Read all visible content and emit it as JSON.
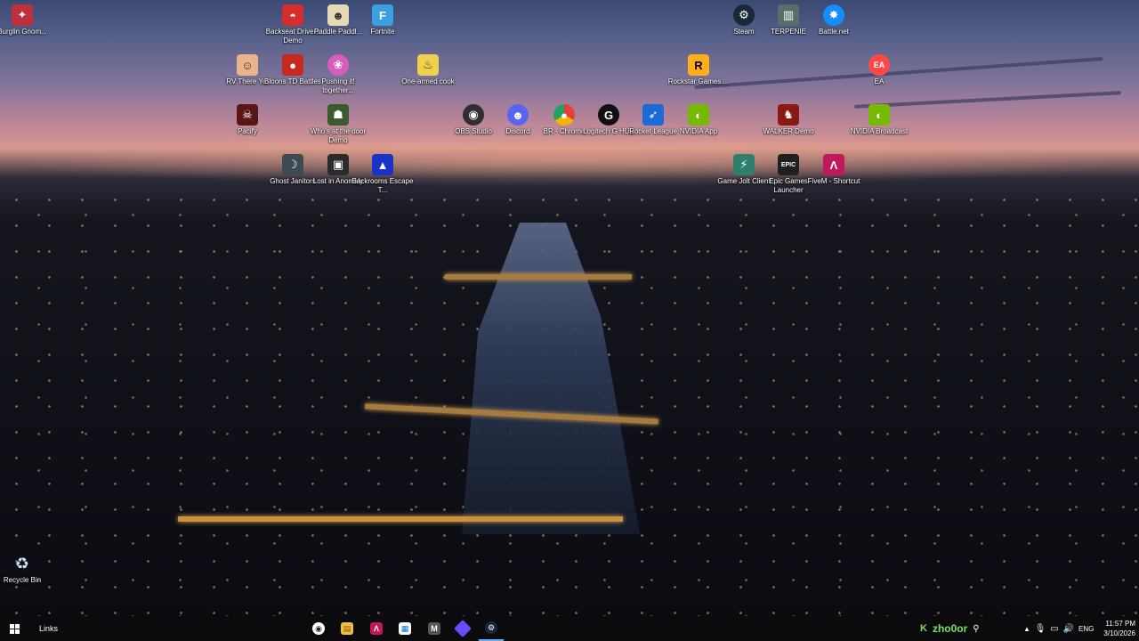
{
  "desktop_icons": [
    {
      "label": "Burglin Gnom...",
      "icon": "burglin-gnomes-icon",
      "color": "#c0303b"
    },
    {
      "label": "Backseat Drivers Demo",
      "icon": "backseat-drivers-icon",
      "color": "#d82c2c"
    },
    {
      "label": "Paddle Paddl...",
      "icon": "paddle-paddle-icon",
      "color": "#e8d9b5"
    },
    {
      "label": "Fortnite",
      "icon": "fortnite-icon",
      "color": "#3aa0e0"
    },
    {
      "label": "Steam",
      "icon": "steam-icon",
      "color": "#1b2838"
    },
    {
      "label": "TERPENIE",
      "icon": "terpenie-icon",
      "color": "#5a6e68"
    },
    {
      "label": "Battle.net",
      "icon": "battlenet-icon",
      "color": "#148eff"
    },
    {
      "label": "RV There Yet",
      "icon": "rv-there-yet-icon",
      "color": "#e9b48a"
    },
    {
      "label": "Bloons TD Battles",
      "icon": "bloons-td-icon",
      "color": "#c7291f"
    },
    {
      "label": "Pushing it! together...",
      "icon": "pushing-it-icon",
      "color": "#d65dbd"
    },
    {
      "label": "One-armed cook",
      "icon": "one-armed-cook-icon",
      "color": "#f0d14a"
    },
    {
      "label": "Rockstar Games ...",
      "icon": "rockstar-icon",
      "color": "#fcaf17"
    },
    {
      "label": "EA",
      "icon": "ea-icon",
      "color": "#ff4747"
    },
    {
      "label": "Pacify",
      "icon": "pacify-icon",
      "color": "#5a1616"
    },
    {
      "label": "Who's at the door Demo",
      "icon": "whos-at-the-door-icon",
      "color": "#3b5a2e"
    },
    {
      "label": "OBS Studio",
      "icon": "obs-icon",
      "color": "#302e31"
    },
    {
      "label": "Discord",
      "icon": "discord-icon",
      "color": "#5865f2"
    },
    {
      "label": "BR - Chrome",
      "icon": "chrome-icon",
      "color": "#e34133"
    },
    {
      "label": "Logitech G HUB",
      "icon": "logitech-icon",
      "color": "#111111"
    },
    {
      "label": "Rocket League",
      "icon": "rocket-league-icon",
      "color": "#1c6ad6"
    },
    {
      "label": "NVIDIA App",
      "icon": "nvidia-app-icon",
      "color": "#76b900"
    },
    {
      "label": "WALKER Demo",
      "icon": "walker-icon",
      "color": "#8a1a10"
    },
    {
      "label": "NVIDIA Broadcast",
      "icon": "nvidia-broadcast-icon",
      "color": "#76b900"
    },
    {
      "label": "Ghost Janitors",
      "icon": "ghost-janitors-icon",
      "color": "#3d4a52"
    },
    {
      "label": "Lost in Anomaly",
      "icon": "lost-in-anomaly-icon",
      "color": "#2b2b2b"
    },
    {
      "label": "Backrooms Escape T...",
      "icon": "backrooms-escape-icon",
      "color": "#1733c9"
    },
    {
      "label": "Game Jolt Client",
      "icon": "game-jolt-icon",
      "color": "#2f7f6f"
    },
    {
      "label": "Epic Games Launcher",
      "icon": "epic-games-icon",
      "color": "#202020"
    },
    {
      "label": "FiveM - Shortcut",
      "icon": "fivem-icon",
      "color": "#c2185b"
    },
    {
      "label": "Recycle Bin",
      "icon": "recycle-bin-icon",
      "color": "#6fa0c8"
    }
  ],
  "taskbar": {
    "start_icon": "windows-start-icon",
    "links_label": "Links",
    "pinned": [
      {
        "icon": "obs-icon",
        "glyph": "◉",
        "color": "#222222"
      },
      {
        "icon": "file-explorer-icon",
        "glyph": "▤",
        "color": "#f0c040"
      },
      {
        "icon": "fivem-icon",
        "glyph": "Λ",
        "color": "#c2185b"
      },
      {
        "icon": "microsoft-store-icon",
        "glyph": "▦",
        "color": "#ffffff"
      },
      {
        "icon": "game-app-icon",
        "glyph": "M",
        "color": "#555555"
      },
      {
        "icon": "proton-vpn-icon",
        "glyph": "▶",
        "color": "#6d4aff"
      },
      {
        "icon": "steam-icon",
        "glyph": "⚙",
        "color": "#1b2838"
      }
    ],
    "kick_user": "zho0or",
    "tray": {
      "language": "ENG",
      "time": "11:57 PM",
      "date": "3/10/2026"
    }
  }
}
